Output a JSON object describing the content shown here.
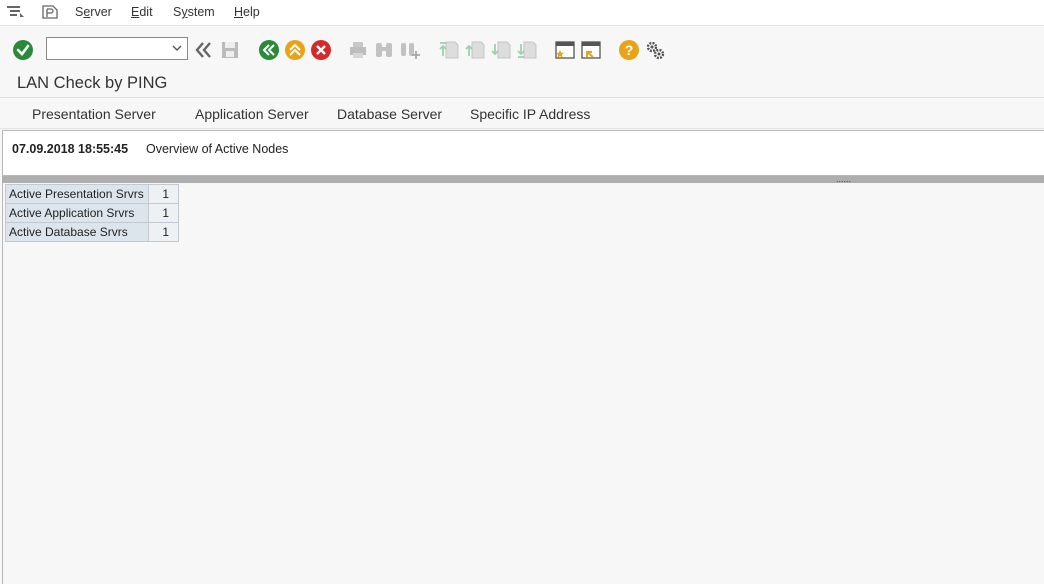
{
  "menubar": {
    "items": [
      "Server",
      "Edit",
      "System",
      "Help"
    ],
    "underline": [
      "e",
      "E",
      "y",
      "H"
    ]
  },
  "toolbar": {
    "command_field_value": "",
    "icons": [
      "enter-icon",
      "back-icon",
      "exit-icon",
      "cancel-icon",
      "print-icon",
      "find-icon",
      "find-next-icon",
      "first-page-icon",
      "previous-page-icon",
      "next-page-icon",
      "last-page-icon",
      "create-session-icon",
      "generate-shortcut-icon",
      "help-icon",
      "customize-layout-icon"
    ]
  },
  "title": "LAN Check by PING",
  "app_toolbar": [
    "Presentation Server",
    "Application Server",
    "Database Server",
    "Specific IP Address"
  ],
  "list_header": {
    "datetime": "07.09.2018 18:55:45",
    "title": "Overview of Active Nodes"
  },
  "splitter_grip": "......",
  "results": [
    {
      "label": "Active Presentation Srvrs",
      "value": "1"
    },
    {
      "label": "Active Application Srvrs",
      "value": "1"
    },
    {
      "label": "Active Database Srvrs",
      "value": "1"
    }
  ],
  "colors": {
    "green": "#2a8a3a",
    "orange": "#e8a317",
    "red": "#d32a2a"
  }
}
